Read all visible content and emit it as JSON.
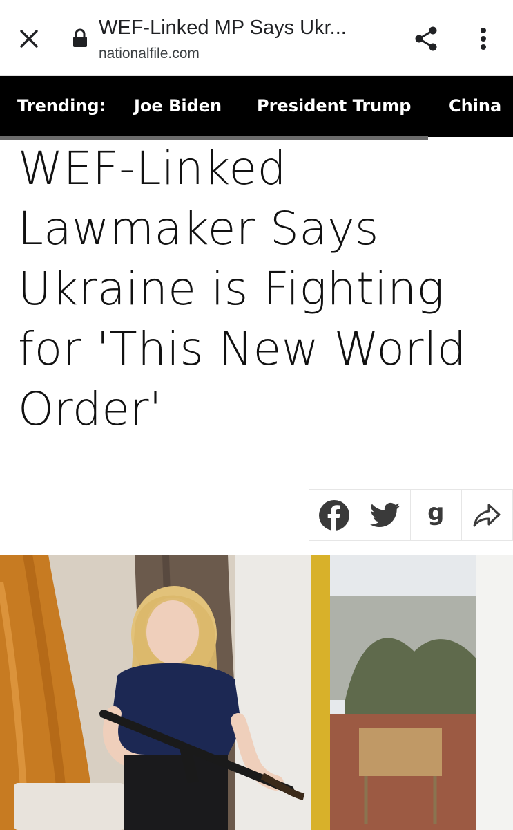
{
  "browser": {
    "page_title": "WEF-Linked MP Says Ukr...",
    "domain": "nationalfile.com",
    "icons": {
      "close": "close-icon",
      "lock": "lock-icon",
      "share": "share-icon",
      "menu": "more-vert-icon"
    }
  },
  "trending": {
    "label": "Trending:",
    "items": [
      "Joe Biden",
      "President Trump",
      "China"
    ]
  },
  "article": {
    "headline": "WEF-Linked Lawmaker Says Ukraine is Fighting for 'This New World Order'",
    "share_buttons": [
      {
        "icon": "facebook-icon"
      },
      {
        "icon": "twitter-icon"
      },
      {
        "icon": "gab-icon",
        "glyph": "g"
      },
      {
        "icon": "forward-share-icon"
      }
    ]
  },
  "colors": {
    "trending_bg": "#000000",
    "text": "#111111",
    "icon_dark": "#202124"
  }
}
